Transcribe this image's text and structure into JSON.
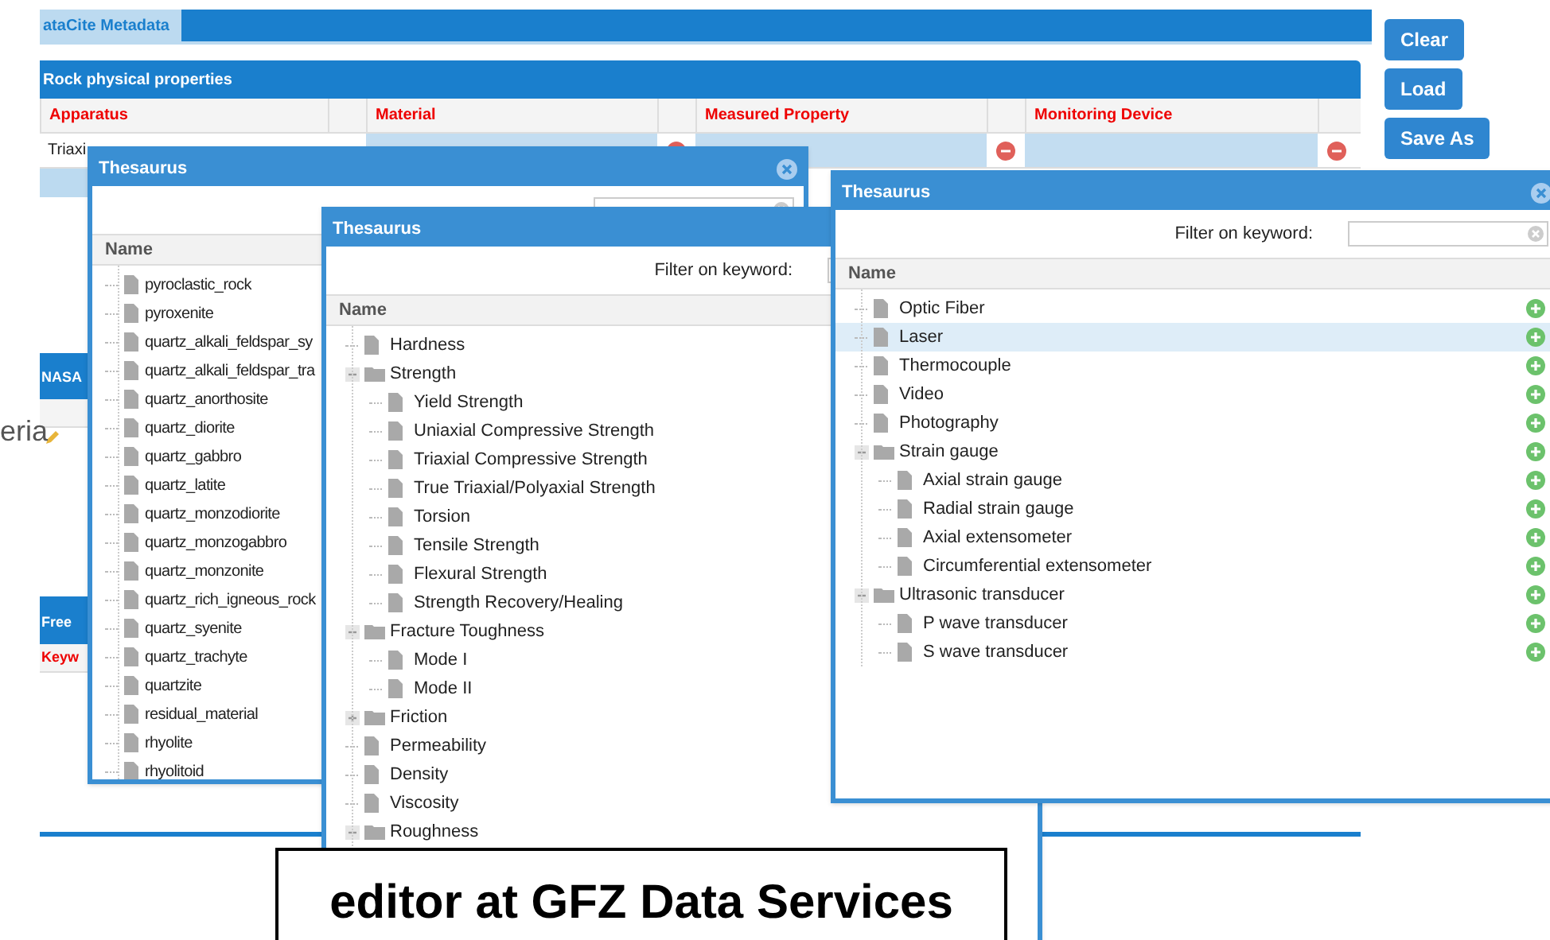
{
  "main_tab": {
    "label": "ataCite Metadata",
    "selected": true
  },
  "side_label": "eria",
  "rock_panel": {
    "title": "Rock physical properties",
    "columns": [
      "Apparatus",
      "Material",
      "Measured Property",
      "Monitoring Device"
    ],
    "first_cell": "Triaxi"
  },
  "side_panels": [
    {
      "title": "NASA"
    },
    {
      "title": "Free",
      "column": "Keyw"
    }
  ],
  "buttons": [
    "Clear",
    "Load",
    "Save As"
  ],
  "windows": [
    {
      "title": "Thesaurus",
      "column": "Name",
      "items": [
        {
          "kind": "leaf",
          "label": "pyroclastic_rock",
          "selected": false
        },
        {
          "kind": "leaf",
          "label": "pyroxenite",
          "selected": false
        },
        {
          "kind": "leaf",
          "label": "quartz_alkali_feldspar_sy",
          "selected": false
        },
        {
          "kind": "leaf",
          "label": "quartz_alkali_feldspar_tra",
          "selected": false
        },
        {
          "kind": "leaf",
          "label": "quartz_anorthosite",
          "selected": false
        },
        {
          "kind": "leaf",
          "label": "quartz_diorite",
          "selected": false
        },
        {
          "kind": "leaf",
          "label": "quartz_gabbro",
          "selected": false
        },
        {
          "kind": "leaf",
          "label": "quartz_latite",
          "selected": false
        },
        {
          "kind": "leaf",
          "label": "quartz_monzodiorite",
          "selected": false
        },
        {
          "kind": "leaf",
          "label": "quartz_monzogabbro",
          "selected": false
        },
        {
          "kind": "leaf",
          "label": "quartz_monzonite",
          "selected": false
        },
        {
          "kind": "leaf",
          "label": "quartz_rich_igneous_rock",
          "selected": false
        },
        {
          "kind": "leaf",
          "label": "quartz_syenite",
          "selected": false
        },
        {
          "kind": "leaf",
          "label": "quartz_trachyte",
          "selected": false
        },
        {
          "kind": "leaf",
          "label": "quartzite",
          "selected": false
        },
        {
          "kind": "leaf",
          "label": "residual_material",
          "selected": false
        },
        {
          "kind": "leaf",
          "label": "rhyolite",
          "selected": false
        },
        {
          "kind": "leaf",
          "label": "rhyolitoid",
          "selected": false
        }
      ]
    },
    {
      "title": "Thesaurus",
      "filter_label": "Filter on keyword:",
      "column": "Name",
      "items": [
        {
          "kind": "leaf",
          "label": "Hardness",
          "selected": false
        },
        {
          "kind": "folder",
          "label": "Strength",
          "selected": false,
          "expanded": true,
          "children": [
            {
              "kind": "leaf",
              "label": "Yield Strength",
              "selected": false
            },
            {
              "kind": "leaf",
              "label": "Uniaxial Compressive Strength",
              "selected": false
            },
            {
              "kind": "leaf",
              "label": "Triaxial Compressive Strength",
              "selected": false
            },
            {
              "kind": "leaf",
              "label": "True Triaxial/Polyaxial Strength",
              "selected": false
            },
            {
              "kind": "leaf",
              "label": "Torsion",
              "selected": false
            },
            {
              "kind": "leaf",
              "label": "Tensile Strength",
              "selected": false
            },
            {
              "kind": "leaf",
              "label": "Flexural Strength",
              "selected": false
            },
            {
              "kind": "leaf",
              "label": "Strength Recovery/Healing",
              "selected": false
            }
          ]
        },
        {
          "kind": "folder",
          "label": "Fracture Toughness",
          "selected": false,
          "expanded": true,
          "children": [
            {
              "kind": "leaf",
              "label": "Mode I",
              "selected": false
            },
            {
              "kind": "leaf",
              "label": "Mode II",
              "selected": false
            }
          ]
        },
        {
          "kind": "folder",
          "label": "Friction",
          "selected": false,
          "expanded": false
        },
        {
          "kind": "leaf",
          "label": "Permeability",
          "selected": false
        },
        {
          "kind": "leaf",
          "label": "Density",
          "selected": false
        },
        {
          "kind": "leaf",
          "label": "Viscosity",
          "selected": false
        },
        {
          "kind": "folder",
          "label": "Roughness",
          "selected": false,
          "expanded": true
        }
      ]
    },
    {
      "title": "Thesaurus",
      "filter_label": "Filter on keyword:",
      "column": "Name",
      "items": [
        {
          "kind": "leaf",
          "label": "Optic Fiber",
          "selected": false
        },
        {
          "kind": "leaf",
          "label": "Laser",
          "selected": true
        },
        {
          "kind": "leaf",
          "label": "Thermocouple",
          "selected": false
        },
        {
          "kind": "leaf",
          "label": "Video",
          "selected": false
        },
        {
          "kind": "leaf",
          "label": "Photography",
          "selected": false
        },
        {
          "kind": "folder",
          "label": "Strain gauge",
          "selected": false,
          "expanded": true,
          "children": [
            {
              "kind": "leaf",
              "label": "Axial strain gauge",
              "selected": false
            },
            {
              "kind": "leaf",
              "label": "Radial strain gauge",
              "selected": false
            },
            {
              "kind": "leaf",
              "label": "Axial extensometer",
              "selected": false
            },
            {
              "kind": "leaf",
              "label": "Circumferential extensometer",
              "selected": false
            }
          ]
        },
        {
          "kind": "folder",
          "label": "Ultrasonic transducer",
          "selected": false,
          "expanded": true,
          "children": [
            {
              "kind": "leaf",
              "label": "P wave transducer",
              "selected": false
            },
            {
              "kind": "leaf",
              "label": "S wave transducer",
              "selected": false
            }
          ]
        }
      ]
    }
  ],
  "caption": "editor at GFZ Data Services"
}
